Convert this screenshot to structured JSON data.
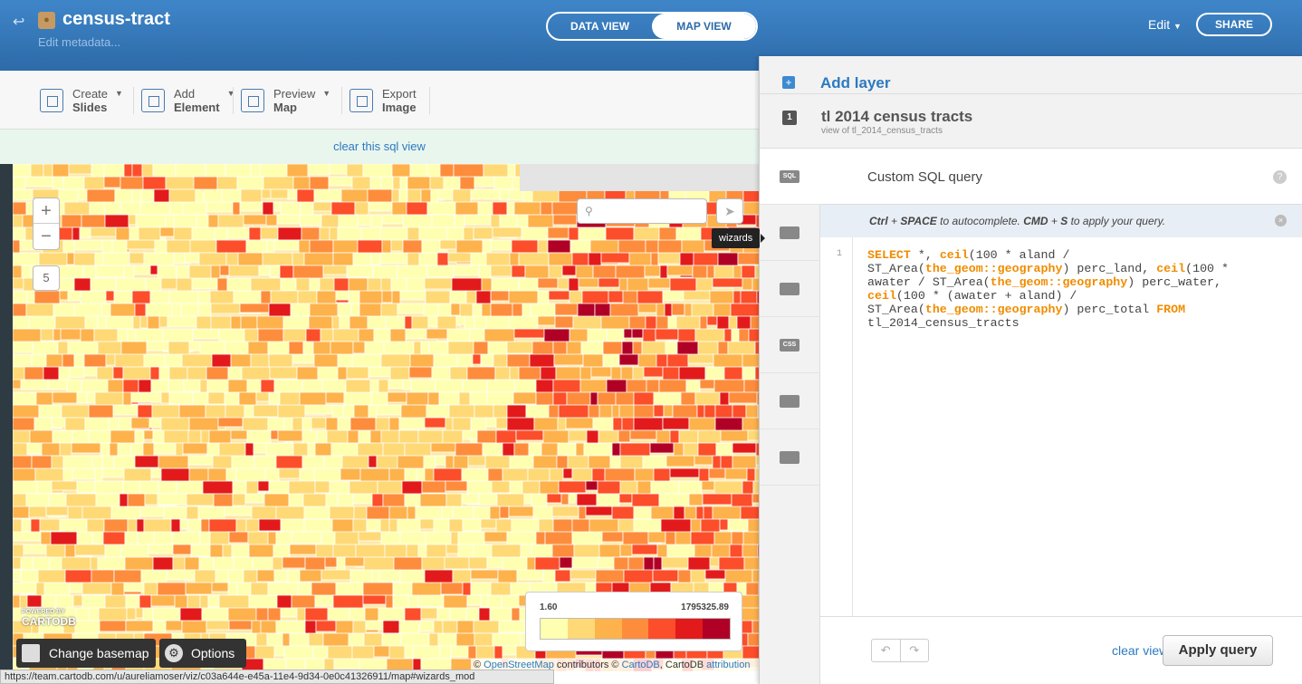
{
  "header": {
    "title": "census-tract",
    "subtitle": "Edit metadata...",
    "views": [
      "DATA VIEW",
      "MAP VIEW"
    ],
    "active_view": "MAP VIEW",
    "edit_label": "Edit",
    "share_label": "SHARE",
    "colors": {
      "bar": "#3579bb",
      "accent": "#2d79c0"
    }
  },
  "toolbar": {
    "tools": [
      {
        "line1": "Create",
        "line2": "Slides",
        "icon": "slides-icon"
      },
      {
        "line1": "Add",
        "line2": "Element",
        "icon": "element-icon"
      },
      {
        "line1": "Preview",
        "line2": "Map",
        "icon": "preview-icon"
      },
      {
        "line1": "Export",
        "line2": "Image",
        "icon": "image-icon"
      }
    ]
  },
  "sql_notice": "clear this sql view",
  "map": {
    "zoom_in": "+",
    "zoom_out": "−",
    "zoom_level": "5",
    "search_placeholder": "",
    "tooltip": "wizards",
    "logo_small": "POWERED BY",
    "logo": "CARTODB",
    "basemap_label": "Change basemap",
    "options_label": "Options",
    "legend": {
      "min": "1.60",
      "max": "1795325.89",
      "colors": [
        "#ffffb2",
        "#fed976",
        "#feb24c",
        "#fd8d3c",
        "#fc4e2a",
        "#e31a1c",
        "#b10026"
      ]
    },
    "attribution": {
      "c1": "©",
      "osm": "OpenStreetMap",
      "mid": "contributors ©",
      "carto": "CartoDB",
      "sep": ",",
      "cartodb": "CartoDB",
      "attr": "attribution"
    }
  },
  "status_url": "https://team.cartodb.com/u/aureliamoser/viz/c03a644e-e45a-11e4-9d34-0e0c41326911/map#wizards_mod",
  "panel": {
    "add_layer": "Add layer",
    "layer_number": "1",
    "layer_name": "tl 2014 census tracts",
    "layer_sub": "view of tl_2014_census_tracts",
    "tabs": [
      "SQL",
      "wizard",
      "infowindow",
      "CSS",
      "legend",
      "filters"
    ],
    "query_title": "Custom SQL query",
    "hint": {
      "k1": "Ctrl",
      "plus": " + ",
      "k2": "SPACE",
      "t1": " to autocomplete. ",
      "k3": "CMD",
      "plus2": " + ",
      "k4": "S",
      "t2": " to apply your query."
    },
    "line_number": "1",
    "code_lines": [
      [
        {
          "k": "SELECT",
          "kw": true
        },
        {
          "k": " *, "
        },
        {
          "k": "ceil",
          "kw": true
        },
        {
          "k": "(100 * aland /"
        }
      ],
      [
        {
          "k": "ST_Area("
        },
        {
          "k": "the_geom::geography",
          "kw": true
        },
        {
          "k": ") perc_land, "
        },
        {
          "k": "ceil",
          "kw": true
        },
        {
          "k": "(100 *"
        }
      ],
      [
        {
          "k": "awater / ST_Area("
        },
        {
          "k": "the_geom::geography",
          "kw": true
        },
        {
          "k": ") perc_water,"
        }
      ],
      [
        {
          "k": "ceil",
          "kw": true
        },
        {
          "k": "(100 * (awater + aland) /"
        }
      ],
      [
        {
          "k": "ST_Area("
        },
        {
          "k": "the_geom::geography",
          "kw": true
        },
        {
          "k": ") perc_total "
        },
        {
          "k": "FROM",
          "kw": true
        }
      ],
      [
        {
          "k": "tl_2014_census_tracts"
        }
      ]
    ],
    "clear_view": "clear view",
    "apply": "Apply query"
  }
}
